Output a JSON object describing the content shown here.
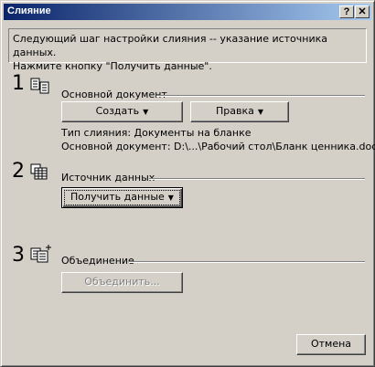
{
  "window": {
    "title": "Слияние",
    "help_glyph": "?",
    "close_glyph": "✕"
  },
  "intro": {
    "line1": "Следующий шаг настройки слияния -- указание источника данных.",
    "line2": "Нажмите кнопку \"Получить данные\"."
  },
  "steps": [
    {
      "number": "1",
      "icon": "main-document-icon",
      "label": "Основной документ",
      "buttons": {
        "create": "Создать",
        "edit": "Правка"
      },
      "merge_type": "Тип слияния: Документы на бланке",
      "main_document": "Основной документ: D:\\...\\Рабочий стол\\Бланк ценника.doc"
    },
    {
      "number": "2",
      "icon": "data-source-icon",
      "label": "Источник данных",
      "buttons": {
        "get_data": "Получить данные"
      }
    },
    {
      "number": "3",
      "icon": "merge-icon",
      "label": "Объединение",
      "buttons": {
        "merge": "Объединить..."
      }
    }
  ],
  "footer": {
    "cancel": "Отмена"
  },
  "colors": {
    "title_start": "#0a246a",
    "title_end": "#a6caf0",
    "face": "#d4d0c8"
  }
}
